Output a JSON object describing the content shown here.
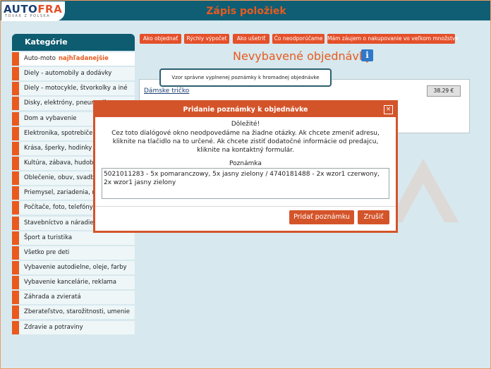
{
  "header": {
    "logo_auto": "AUTO",
    "logo_fra": "FRA",
    "logo_sub": "TOVAR Z POLSKA",
    "title": "Zápis položiek"
  },
  "sidebar": {
    "title": "Kategórie",
    "popular_label": "najhľadanejšie",
    "items": [
      "Auto-moto",
      "Diely - automobily a dodávky",
      "Diely - motocykle, štvorkolky a iné",
      "Disky, elektróny, pneumatiky",
      "Dom a vybavenie",
      "Elektronika, spotrebiče",
      "Krása, šperky, hodinky",
      "Kultúra, zábava, hudobniny",
      "Oblečenie, obuv, svadba",
      "Priemysel, zariadenia, nástroje",
      "Počítače, foto, telefóny",
      "Stavebníctvo a náradie",
      "Šport a turistika",
      "Všetko pre deti",
      "Vybavenie autodielne, oleje, farby",
      "Vybavenie kancelárie, reklama",
      "Záhrada a zvieratá",
      "Zberateľstvo, starožitnosti, umenie",
      "Zdravie a potraviny"
    ]
  },
  "top_buttons": [
    "Ako objednať",
    "Rýchly výpočet",
    "Ako ušetriť",
    "Čo neodporúčame",
    "Mám záujem o nakupovanie vo veľkom množstve"
  ],
  "main": {
    "title": "Nevybavené objednávky",
    "tooltip": "Vzor správne vyplnenej poznámky k hromadnej objednávke",
    "product": "Dámske tričko",
    "price": "38.29 €"
  },
  "dialog": {
    "title": "Pridanie poznámky k objednávke",
    "close": "×",
    "important": "Dôležité!",
    "text": "Cez toto dialógové okno neodpovedáme na žiadne otázky. Ak chcete zmeniť adresu, kliknite na tlačidlo na to určené. Ak chcete zistiť dodatočné informácie od predajcu, kliknite na kontaktný formulár.",
    "note_label": "Poznámka",
    "note_value": "5021011283 - 5x pomaranczowy, 5x jasny zielony / 4740181488 - 2x wzor1 czerwony, 2x wzor1 jasny zielony",
    "add_button": "Pridať poznámku",
    "cancel_button": "Zrušiť"
  },
  "colors": {
    "accent": "#e85a1e",
    "header_bg": "#0f5e74",
    "page_bg": "#d7e8ee",
    "info_icon": "#2f77c9"
  },
  "icons": {
    "info": "info-icon",
    "close": "close-icon"
  }
}
